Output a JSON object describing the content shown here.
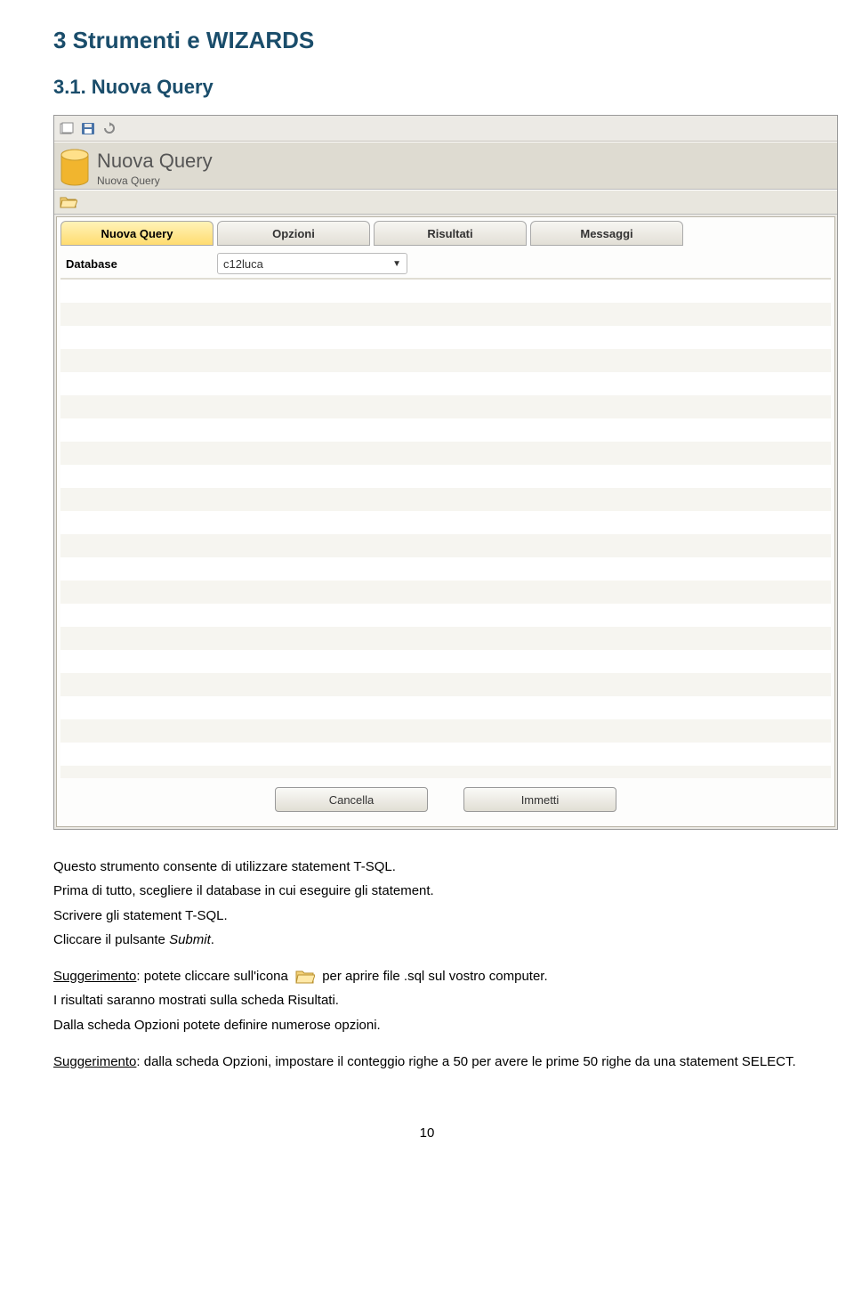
{
  "heading": "3 Strumenti e  WIZARDS",
  "subheading": "3.1. Nuova Query",
  "screenshot": {
    "header_title": "Nuova Query",
    "header_sub": "Nuova Query",
    "tabs": [
      "Nuova Query",
      "Opzioni",
      "Risultati",
      "Messaggi"
    ],
    "db_label": "Database",
    "db_value": "c12luca",
    "buttons": {
      "cancel": "Cancella",
      "submit": "Immetti"
    }
  },
  "body": {
    "p1": "Questo strumento consente di utilizzare statement T-SQL.",
    "p2": "Prima di tutto, scegliere il database in cui eseguire gli statement.",
    "p3": "Scrivere gli statement T-SQL.",
    "p4a": "Cliccare il pulsante ",
    "p4b": "Submit",
    "p4c": ".",
    "s1_label": "Suggerimento",
    "s1a": ": potete cliccare sull'icona ",
    "s1b": " per aprire file .sql sul vostro computer.",
    "p5": "I risultati saranno mostrati sulla scheda Risultati.",
    "p6": "Dalla scheda Opzioni potete definire numerose opzioni.",
    "s2_label": "Suggerimento",
    "s2": ": dalla scheda Opzioni, impostare il conteggio righe a 50 per avere le prime 50 righe da una statement SELECT."
  },
  "page_number": "10"
}
